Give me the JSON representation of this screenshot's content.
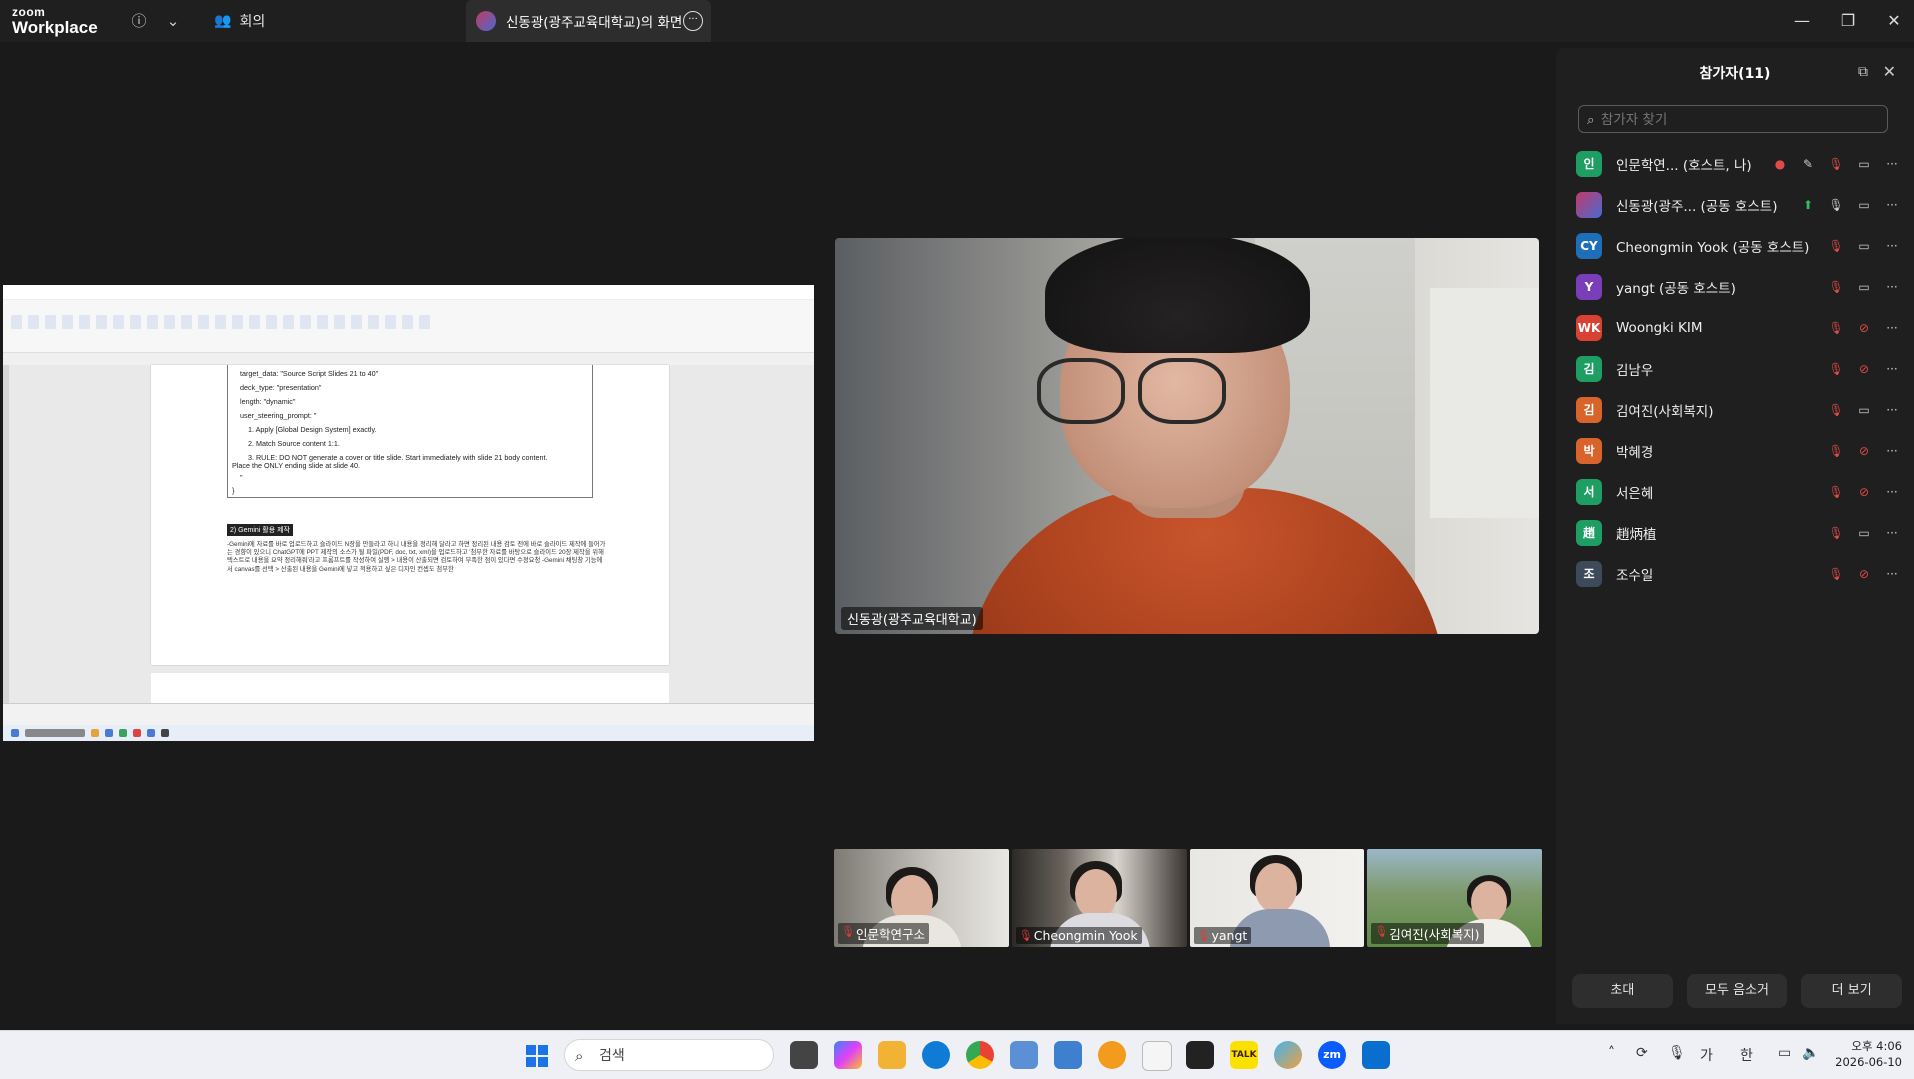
{
  "app": {
    "brand_small": "zoom",
    "brand_large": "Workplace"
  },
  "topbar": {
    "meeting_tab": "회의",
    "share_tab": "신동광(광주교육대학교)의 화면"
  },
  "shared_doc": {
    "code_lines": [
      "target_data: \"Source Script Slides 21 to 40\"",
      "deck_type: \"presentation\"",
      "length: \"dynamic\"",
      "user_steering_prompt: \"",
      "1. Apply [Global Design System] exactly.",
      "2. Match Source content 1:1.",
      "3. RULE: DO NOT generate a cover or title slide. Start immediately with slide 21 body content.",
      "Place the ONLY ending slide at slide 40.",
      "\"",
      "}"
    ],
    "heading": "2) Gemini 활용 제작",
    "paragraph": "-Gemini에 자료를 바로 업로드하고 슬라이드 N장을 만들라고 하니 내용을 정리해 달라고 하면 정리된 내용 검토 전에 바로 슬라이드 제작에 들어가는 경향이 있으니 ChatGPT에 PPT 제작의 소스가 될 파일(PDF, doc, txt, xml)을 업로드하고 '첨부한 자료를 바탕으로 슬라이드 20장 제작을 위해 텍스트로 내용을 요약 정리해줘'라고 프롬프트를 작성하여 실행 > 내용이 산출되면 검토하여 부족한 점이 있다면 수정요청 -Gemini 채팅창 기능에서 canvas를 선택 > 산출된 내용을 Gemini에 넣고 적용하고 싶은 디자인 컨셉도 첨부한"
  },
  "speaker": {
    "name": "신동광(광주교육대학교)"
  },
  "thumbnails": [
    {
      "name": "인문학연구소"
    },
    {
      "name": "Cheongmin Yook"
    },
    {
      "name": "yangt"
    },
    {
      "name": "김여진(사회복지)"
    }
  ],
  "panel": {
    "title": "참가자(11)",
    "search_placeholder": "참가자 찾기",
    "participants": [
      {
        "avatar": "인",
        "color": "#1e9e63",
        "name": "인문학연...  (호스트, 나)",
        "mic": "muted",
        "video": "on"
      },
      {
        "avatar": "",
        "color": "#c23a6a",
        "name": "신동광(광주...  (공동 호스트)",
        "mic": "on",
        "video": "on"
      },
      {
        "avatar": "CY",
        "color": "#1f6fb8",
        "name": "Cheongmin Yook (공동 호스트)",
        "mic": "muted",
        "video": "on"
      },
      {
        "avatar": "Y",
        "color": "#7a3fb8",
        "name": "yangt (공동 호스트)",
        "mic": "muted",
        "video": "on"
      },
      {
        "avatar": "WK",
        "color": "#d94133",
        "name": "Woongki KIM",
        "mic": "muted",
        "video": "off"
      },
      {
        "avatar": "김",
        "color": "#1e9e63",
        "name": "김남우",
        "mic": "muted",
        "video": "off"
      },
      {
        "avatar": "김",
        "color": "#d9642b",
        "name": "김여진(사회복지)",
        "mic": "muted",
        "video": "on"
      },
      {
        "avatar": "박",
        "color": "#d9642b",
        "name": "박혜경",
        "mic": "muted",
        "video": "off"
      },
      {
        "avatar": "서",
        "color": "#1e9e63",
        "name": "서은혜",
        "mic": "muted",
        "video": "off"
      },
      {
        "avatar": "趙",
        "color": "#1e9e63",
        "name": "趙炳植",
        "mic": "muted",
        "video": "on"
      },
      {
        "avatar": "조",
        "color": "#3c4a5a",
        "name": "조수일",
        "mic": "muted",
        "video": "off"
      }
    ],
    "buttons": {
      "invite": "초대",
      "mute_all": "모두 음소거",
      "more": "더 보기"
    }
  },
  "taskbar": {
    "search_placeholder": "검색",
    "tray_ime1": "가",
    "tray_ime2": "한",
    "time": "오후 4:06",
    "date": "2026-06-10"
  }
}
